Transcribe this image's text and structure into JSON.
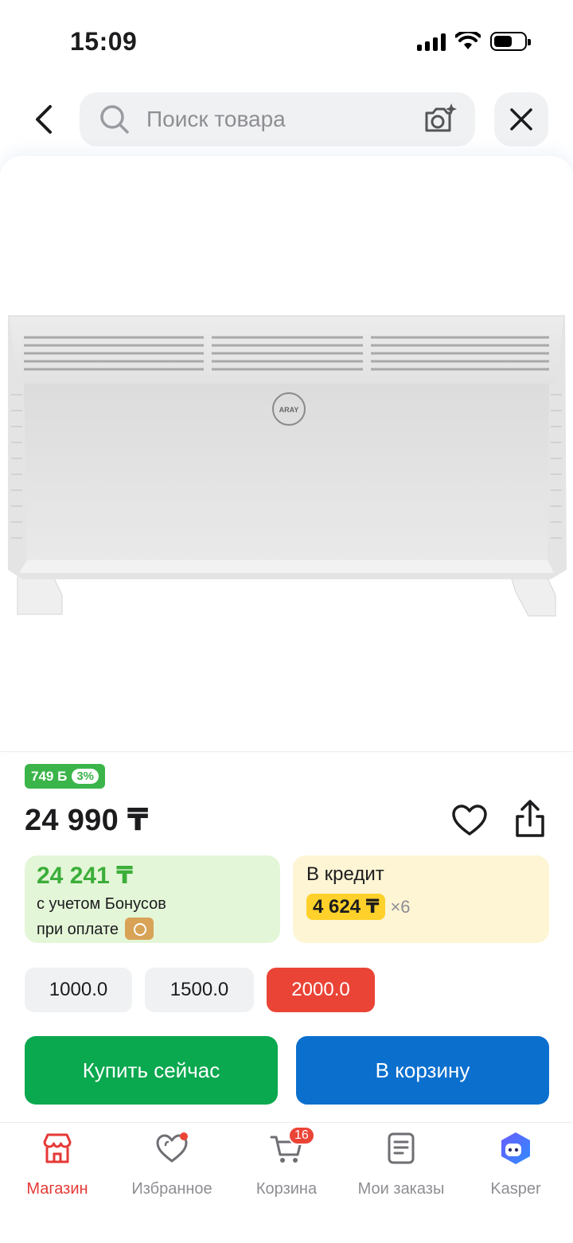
{
  "status_bar": {
    "time": "15:09",
    "icons": [
      "signal-icon",
      "wifi-icon",
      "battery-icon"
    ]
  },
  "header": {
    "search_placeholder": "Поиск товара",
    "icons": [
      "back-arrow-icon",
      "search-icon",
      "camera-icon",
      "close-icon"
    ]
  },
  "product": {
    "brand_logo": "ARAY",
    "bonus_amount": "749 Б",
    "bonus_percent": "3%",
    "price": "24 990 ₸"
  },
  "bonus_card": {
    "price": "24 241 ₸",
    "line1": "с учетом Бонусов",
    "line2": "при оплате"
  },
  "credit_card": {
    "title": "В кредит",
    "amount": "4 624 ₸",
    "times": "×6"
  },
  "options": [
    {
      "label": "1000.0",
      "selected": false
    },
    {
      "label": "1500.0",
      "selected": false
    },
    {
      "label": "2000.0",
      "selected": true
    }
  ],
  "actions": {
    "buy_now": "Купить сейчас",
    "add_to_cart": "В корзину"
  },
  "bottom_nav": [
    {
      "label": "Магазин",
      "icon": "shop-icon",
      "active": true
    },
    {
      "label": "Избранное",
      "icon": "heart-icon",
      "active": false
    },
    {
      "label": "Корзина",
      "icon": "cart-icon",
      "active": false,
      "badge": "16"
    },
    {
      "label": "Мои заказы",
      "icon": "orders-icon",
      "active": false
    },
    {
      "label": "Kasper",
      "icon": "kasper-icon",
      "active": false
    }
  ],
  "colors": {
    "accent_red": "#ea4437",
    "buy_green": "#0aa84f",
    "cart_blue": "#0b6fce",
    "bonus_green": "#3bb54a",
    "credit_yellow": "#ffd12a"
  }
}
